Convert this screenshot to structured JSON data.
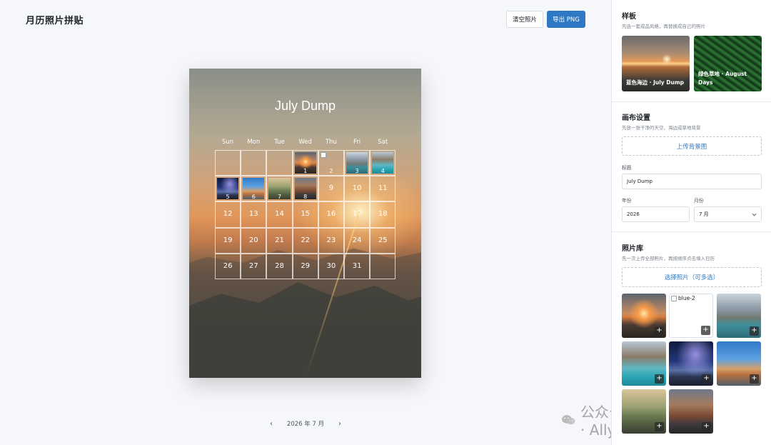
{
  "header": {
    "title": "月历照片拼贴",
    "clear_label": "清空照片",
    "export_label": "导出 PNG"
  },
  "poster": {
    "title": "July Dump",
    "weekdays": [
      "Sun",
      "Mon",
      "Tue",
      "Wed",
      "Thu",
      "Fri",
      "Sat"
    ],
    "days": [
      {
        "n": "",
        "p": null
      },
      {
        "n": "",
        "p": null
      },
      {
        "n": "",
        "p": null
      },
      {
        "n": "1",
        "p": "sunset"
      },
      {
        "n": "2",
        "p": "broken"
      },
      {
        "n": "3",
        "p": "lake"
      },
      {
        "n": "4",
        "p": "turquoise"
      },
      {
        "n": "5",
        "p": "milkyway"
      },
      {
        "n": "6",
        "p": "blue-mountain"
      },
      {
        "n": "7",
        "p": "road"
      },
      {
        "n": "8",
        "p": "canyon-road"
      },
      {
        "n": "9",
        "p": null
      },
      {
        "n": "10",
        "p": null
      },
      {
        "n": "11",
        "p": null
      },
      {
        "n": "12",
        "p": null
      },
      {
        "n": "13",
        "p": null
      },
      {
        "n": "14",
        "p": null
      },
      {
        "n": "15",
        "p": null
      },
      {
        "n": "16",
        "p": null
      },
      {
        "n": "17",
        "p": null
      },
      {
        "n": "18",
        "p": null
      },
      {
        "n": "19",
        "p": null
      },
      {
        "n": "20",
        "p": null
      },
      {
        "n": "21",
        "p": null
      },
      {
        "n": "22",
        "p": null
      },
      {
        "n": "23",
        "p": null
      },
      {
        "n": "24",
        "p": null
      },
      {
        "n": "25",
        "p": null
      },
      {
        "n": "26",
        "p": null
      },
      {
        "n": "27",
        "p": null
      },
      {
        "n": "28",
        "p": null
      },
      {
        "n": "29",
        "p": null
      },
      {
        "n": "30",
        "p": null
      },
      {
        "n": "31",
        "p": null
      },
      {
        "n": "",
        "p": null
      }
    ]
  },
  "month_nav": {
    "prev": "‹",
    "label": "2026 年 7 月",
    "next": "›"
  },
  "sidebar": {
    "templates": {
      "title": "样板",
      "desc": "先选一套成品风格，再替换成自己的照片",
      "items": [
        {
          "label": "蓝色海边 · July Dump"
        },
        {
          "label": "绿色草地 · August Days"
        }
      ]
    },
    "canvas": {
      "title": "画布设置",
      "desc": "先放一张干净的天空、海边或草地背景",
      "upload_label": "上传背景图",
      "title_label": "标题",
      "title_value": "July Dump",
      "year_label": "年份",
      "year_value": "2026",
      "month_label": "月份",
      "month_value": "7 月"
    },
    "library": {
      "title": "照片库",
      "desc": "先一次上传全部照片，再按顺序点击填入日历",
      "select_label": "选择照片（可多选）",
      "broken_alt": "blue-2",
      "add_symbol": "+"
    }
  },
  "watermark": {
    "text": "公众号 · AllyL"
  }
}
